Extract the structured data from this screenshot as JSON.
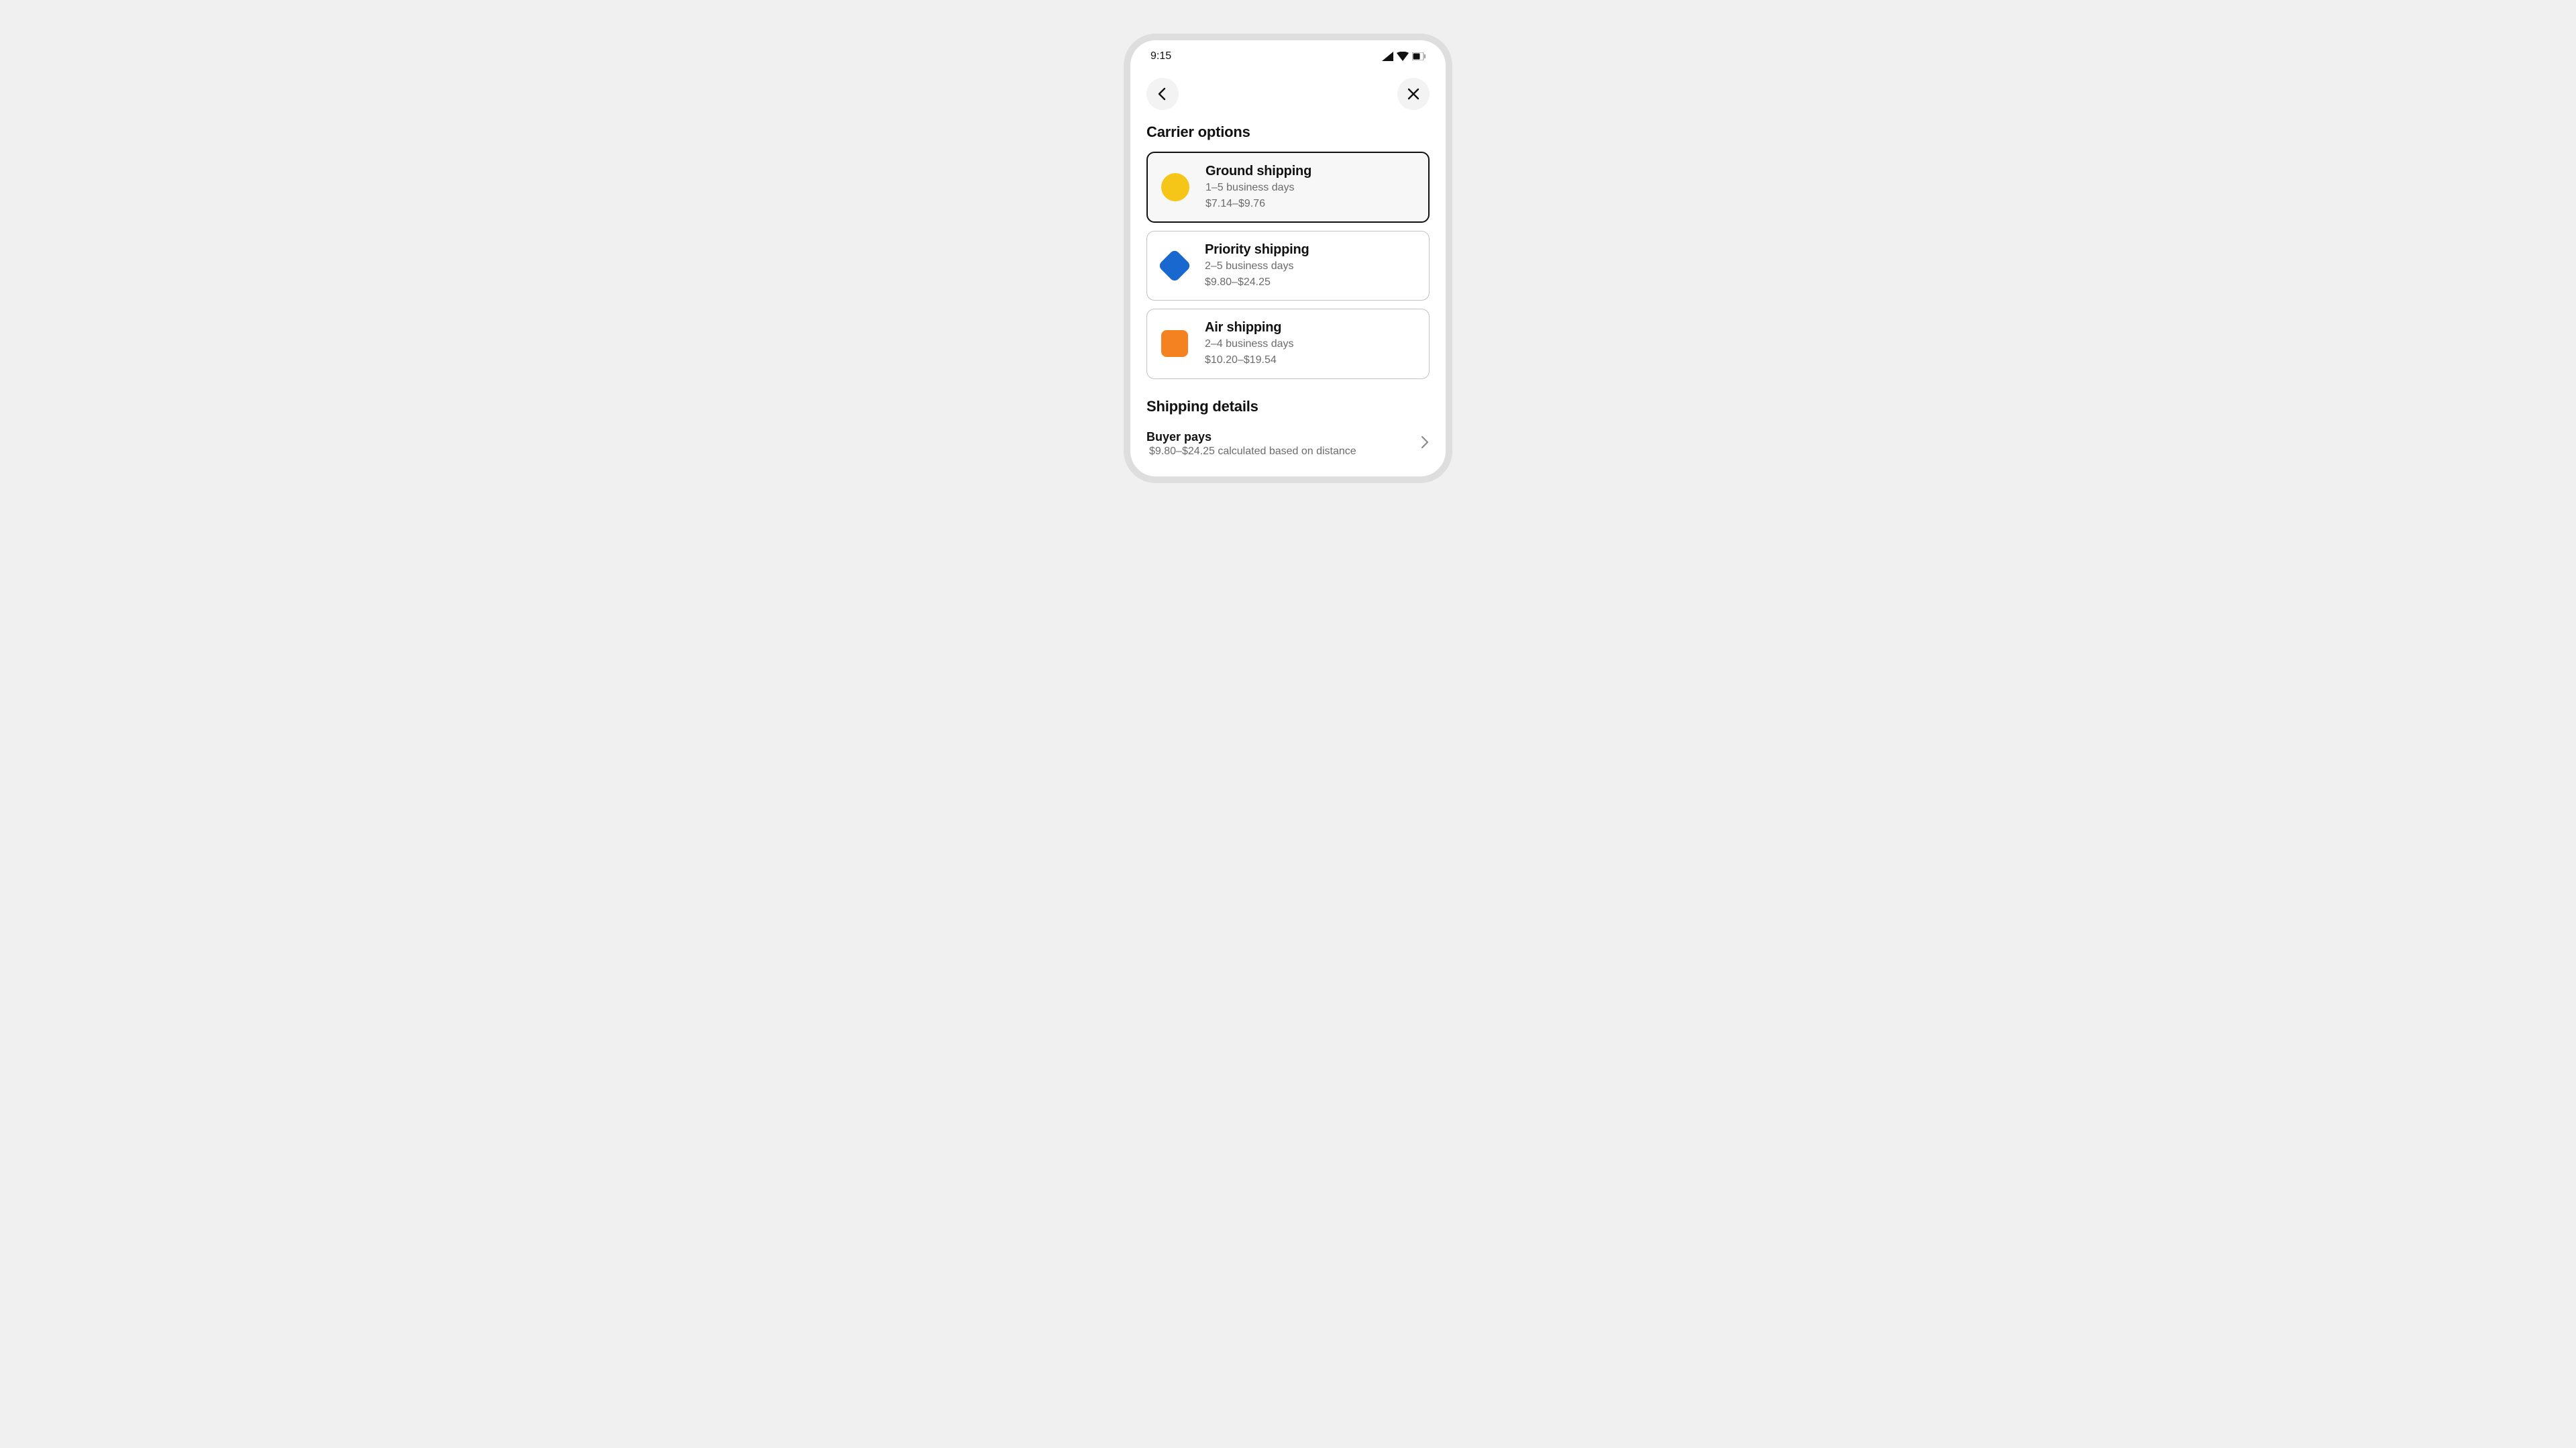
{
  "statusBar": {
    "time": "9:15"
  },
  "sections": {
    "carrierTitle": "Carrier options",
    "shippingTitle": "Shipping details"
  },
  "carriers": [
    {
      "title": "Ground shipping",
      "duration": "1–5 business days",
      "price": "$7.14–$9.76"
    },
    {
      "title": "Priority shipping",
      "duration": "2–5 business days",
      "price": "$9.80–$24.25"
    },
    {
      "title": "Air shipping",
      "duration": "2–4 business days",
      "price": "$10.20–$19.54"
    }
  ],
  "shippingDetail": {
    "title": "Buyer pays",
    "sub": "$9.80–$24.25 calculated based on distance"
  }
}
